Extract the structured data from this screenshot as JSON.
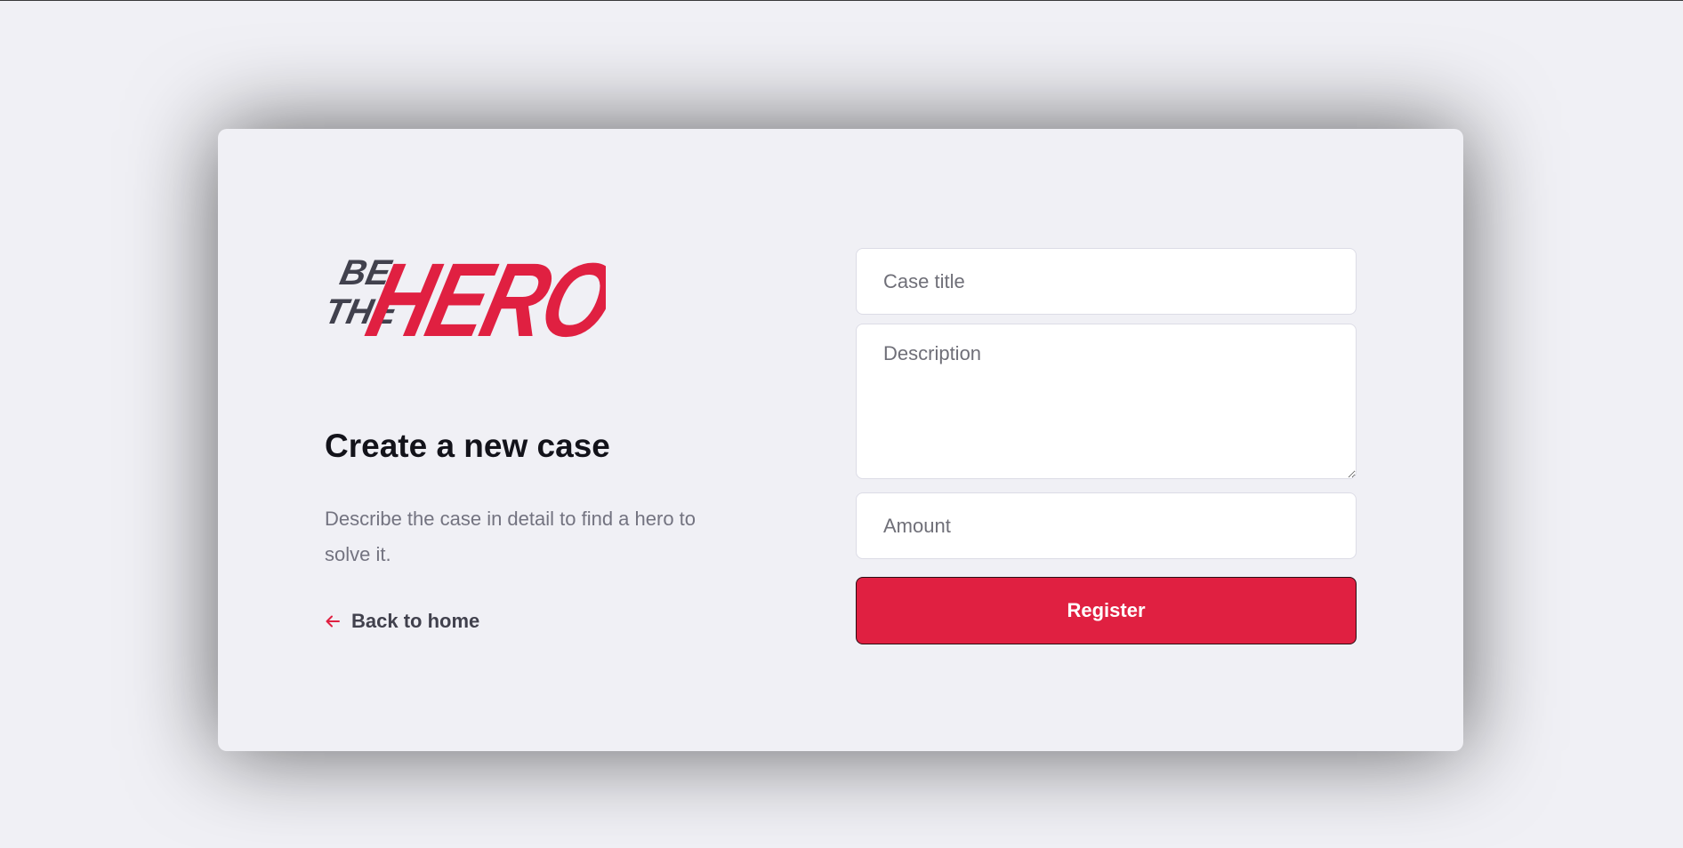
{
  "brand": {
    "logo_line1": "BE",
    "logo_line2": "THE",
    "logo_word": "HERO",
    "accent_color": "#e02041",
    "dark_color": "#41414d"
  },
  "page": {
    "title": "Create a new case",
    "description": "Describe the case in detail to find a hero to solve it."
  },
  "nav": {
    "back_label": "Back to home",
    "back_icon": "arrow-left-icon"
  },
  "form": {
    "title_placeholder": "Case title",
    "title_value": "",
    "description_placeholder": "Description",
    "description_value": "",
    "amount_placeholder": "Amount",
    "amount_value": "",
    "submit_label": "Register"
  }
}
